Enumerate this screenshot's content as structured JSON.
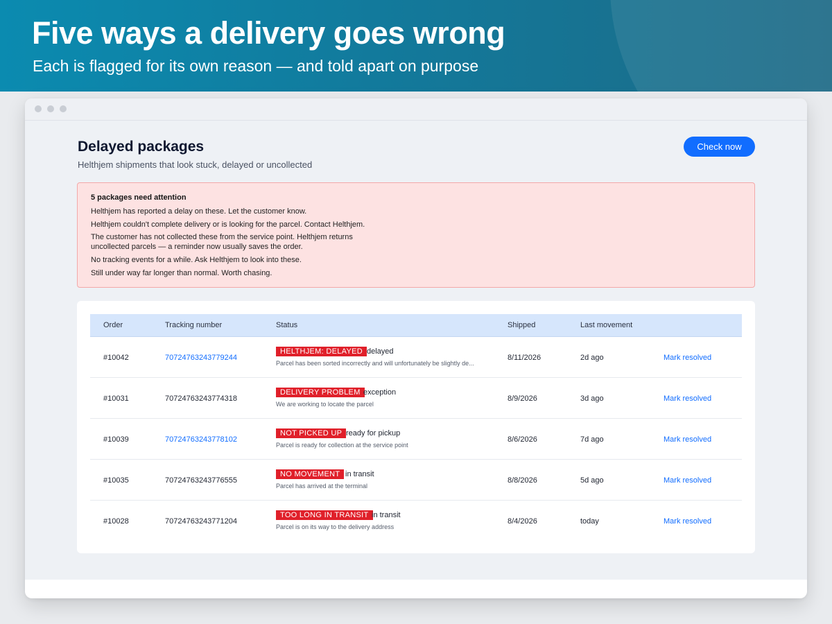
{
  "hero": {
    "title": "Five ways a delivery goes wrong",
    "subtitle": "Each is flagged for its own reason — and told apart on purpose"
  },
  "page": {
    "title": "Delayed packages",
    "subtitle": "Helthjem shipments that look stuck, delayed or uncollected",
    "check_button": "Check now"
  },
  "alert": {
    "heading": "5 packages need attention",
    "lines": [
      "Helthjem has reported a delay on these. Let the customer know.",
      "Helthjem couldn't complete delivery or is looking for the parcel. Contact Helthjem.",
      "The customer has not collected these from the service point. Helthjem returns uncollected parcels — a reminder now usually saves the order.",
      "No tracking events for a while. Ask Helthjem to look into these.",
      "Still under way far longer than normal. Worth chasing."
    ]
  },
  "table": {
    "headers": {
      "order": "Order",
      "tracking": "Tracking number",
      "status": "Status",
      "shipped": "Shipped",
      "last_movement": "Last movement"
    },
    "resolve_label": "Mark resolved",
    "rows": [
      {
        "order": "#10042",
        "tracking": "70724763243779244",
        "badge": "HELTHJEM: DELAYED",
        "status": "delayed",
        "detail": "Parcel has been sorted incorrectly and will unfortunately be slightly de...",
        "shipped": "8/11/2026",
        "last_movement": "2d ago"
      },
      {
        "order": "#10031",
        "tracking": "70724763243774318",
        "badge": "DELIVERY PROBLEM",
        "status": "exception",
        "detail": "We are working to locate the parcel",
        "shipped": "8/9/2026",
        "last_movement": "3d ago"
      },
      {
        "order": "#10039",
        "tracking": "70724763243778102",
        "badge": "NOT PICKED UP",
        "status": "ready for pickup",
        "detail": "Parcel is ready for collection at the service point",
        "shipped": "8/6/2026",
        "last_movement": "7d ago"
      },
      {
        "order": "#10035",
        "tracking": "70724763243776555",
        "badge": "NO MOVEMENT",
        "status": "in transit",
        "detail": "Parcel has arrived at the terminal",
        "shipped": "8/8/2026",
        "last_movement": "5d ago"
      },
      {
        "order": "#10028",
        "tracking": "70724763243771204",
        "badge": "TOO LONG IN TRANSIT",
        "status": "in transit",
        "detail": "Parcel is on its way to the delivery address",
        "shipped": "8/4/2026",
        "last_movement": "today"
      }
    ]
  },
  "colors": {
    "accent": "#116dff",
    "badge": "#e0202a",
    "alert_bg": "#fde2e2",
    "header_bg": "#d6e6fc"
  }
}
